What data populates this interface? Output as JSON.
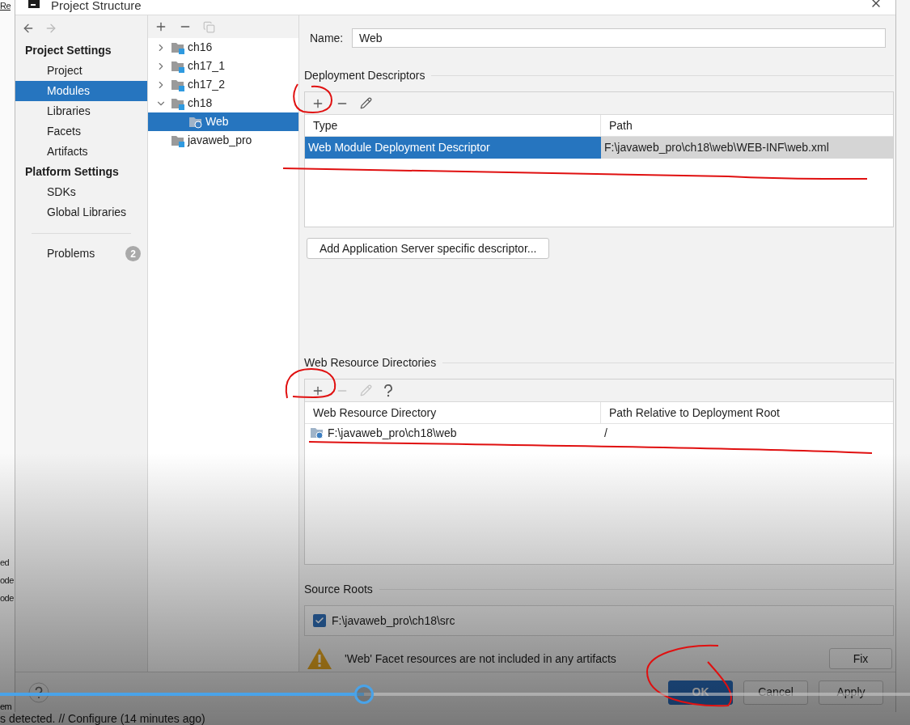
{
  "background_ide": {
    "edge_texts": [
      "Re",
      "ed",
      "ode",
      "ode",
      "em"
    ],
    "status_text": "s detected. // Configure (14 minutes ago)"
  },
  "window": {
    "title": "Project Structure"
  },
  "sidebar": {
    "sections": [
      {
        "title": "Project Settings",
        "items": [
          {
            "label": "Project",
            "selected": false
          },
          {
            "label": "Modules",
            "selected": true
          },
          {
            "label": "Libraries",
            "selected": false
          },
          {
            "label": "Facets",
            "selected": false
          },
          {
            "label": "Artifacts",
            "selected": false
          }
        ]
      },
      {
        "title": "Platform Settings",
        "items": [
          {
            "label": "SDKs",
            "selected": false
          },
          {
            "label": "Global Libraries",
            "selected": false
          }
        ]
      }
    ],
    "problems": {
      "label": "Problems",
      "count": "2"
    }
  },
  "tree": {
    "toolbar": [
      {
        "kind": "add",
        "disabled": false
      },
      {
        "kind": "remove",
        "disabled": false
      },
      {
        "kind": "copy",
        "disabled": true
      }
    ],
    "items": [
      {
        "label": "ch16",
        "kind": "module",
        "expandable": true,
        "expanded": false,
        "selected": false
      },
      {
        "label": "ch17_1",
        "kind": "module",
        "expandable": true,
        "expanded": false,
        "selected": false
      },
      {
        "label": "ch17_2",
        "kind": "module",
        "expandable": true,
        "expanded": false,
        "selected": false
      },
      {
        "label": "ch18",
        "kind": "module",
        "expandable": true,
        "expanded": true,
        "selected": false,
        "children": [
          {
            "label": "Web",
            "kind": "web",
            "expandable": false,
            "selected": true
          }
        ]
      },
      {
        "label": "javaweb_pro",
        "kind": "module",
        "expandable": false,
        "selected": false
      }
    ]
  },
  "name_field": {
    "label": "Name:",
    "value": "Web"
  },
  "deployment_descriptors": {
    "title": "Deployment Descriptors",
    "toolbar": [
      {
        "kind": "add",
        "disabled": false
      },
      {
        "kind": "remove",
        "disabled": false
      },
      {
        "kind": "edit",
        "disabled": false
      }
    ],
    "columns": [
      "Type",
      "Path"
    ],
    "rows": [
      {
        "cells": [
          "Web Module Deployment Descriptor",
          "F:\\javaweb_pro\\ch18\\web\\WEB-INF\\web.xml"
        ],
        "selected": true
      }
    ],
    "add_button": "Add Application Server specific descriptor..."
  },
  "web_resource_directories": {
    "title": "Web Resource Directories",
    "toolbar": [
      {
        "kind": "add",
        "disabled": false
      },
      {
        "kind": "remove",
        "disabled": true
      },
      {
        "kind": "edit",
        "disabled": true
      },
      {
        "kind": "help",
        "disabled": false
      }
    ],
    "columns": [
      "Web Resource Directory",
      "Path Relative to Deployment Root"
    ],
    "rows": [
      {
        "cells": [
          "F:\\javaweb_pro\\ch18\\web",
          "/"
        ],
        "selected": false
      }
    ]
  },
  "source_roots": {
    "title": "Source Roots",
    "items": [
      {
        "path": "F:\\javaweb_pro\\ch18\\src",
        "checked": true
      }
    ]
  },
  "warning": {
    "text": "'Web' Facet resources are not included in any artifacts",
    "button": "Fix"
  },
  "footer_buttons": [
    {
      "label": "OK",
      "kind": "primary"
    },
    {
      "label": "Cancel",
      "kind": "normal"
    },
    {
      "label": "Apply",
      "kind": "normal"
    }
  ],
  "video_player": {
    "seek_bar": {
      "level": 0.4
    }
  }
}
